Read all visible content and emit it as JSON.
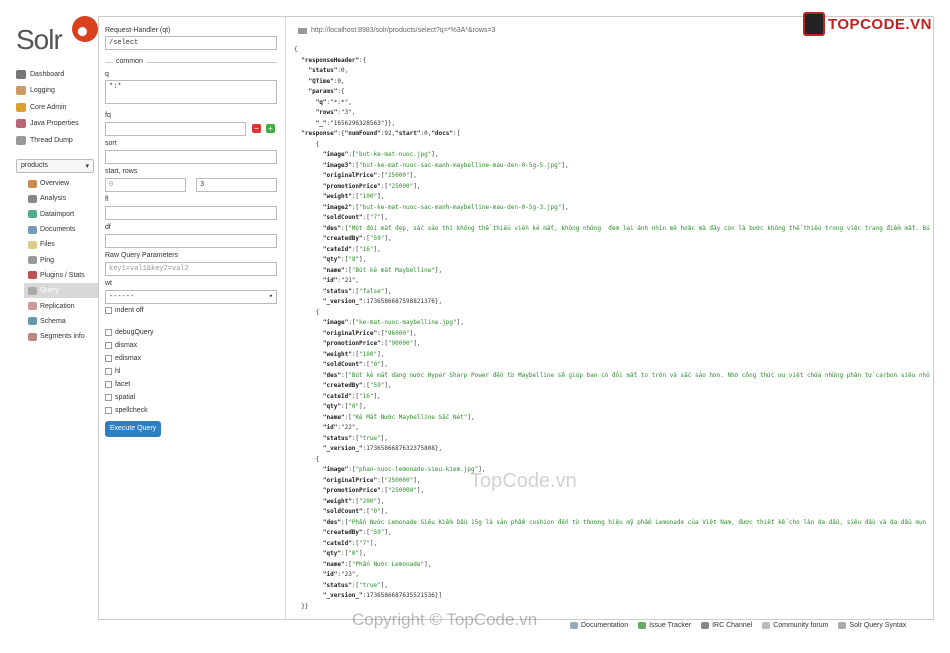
{
  "nav": [
    {
      "label": "Dashboard",
      "icon": "dashboard-icon"
    },
    {
      "label": "Logging",
      "icon": "logging-icon"
    },
    {
      "label": "Core Admin",
      "icon": "core-admin-icon"
    },
    {
      "label": "Java Properties",
      "icon": "java-properties-icon"
    },
    {
      "label": "Thread Dump",
      "icon": "thread-dump-icon"
    }
  ],
  "core_selector": {
    "value": "products"
  },
  "core_nav": [
    {
      "label": "Overview",
      "icon": "overview-icon"
    },
    {
      "label": "Analysis",
      "icon": "analysis-icon"
    },
    {
      "label": "Dataimport",
      "icon": "dataimport-icon"
    },
    {
      "label": "Documents",
      "icon": "documents-icon"
    },
    {
      "label": "Files",
      "icon": "files-icon"
    },
    {
      "label": "Ping",
      "icon": "ping-icon"
    },
    {
      "label": "Plugins / Stats",
      "icon": "plugins-icon"
    },
    {
      "label": "Query",
      "icon": "query-icon"
    },
    {
      "label": "Replication",
      "icon": "replication-icon"
    },
    {
      "label": "Schema",
      "icon": "schema-icon"
    },
    {
      "label": "Segments info",
      "icon": "segments-icon"
    }
  ],
  "form": {
    "qt_label": "Request-Handler (qt)",
    "qt_value": "/select",
    "common_label": "common",
    "q_label": "q",
    "q_value": "*:*",
    "fq_label": "fq",
    "fq_value": "",
    "sort_label": "sort",
    "sort_value": "",
    "start_rows_label": "start, rows",
    "start_placeholder": "0",
    "rows_value": "3",
    "fl_label": "fl",
    "fl_value": "",
    "df_label": "df",
    "df_value": "",
    "raw_label": "Raw Query Parameters",
    "raw_placeholder": "key1=val1&key2=val2",
    "wt_label": "wt",
    "wt_value": "------",
    "indent_label": "indent off",
    "debug_label": "debugQuery",
    "dismax_label": "dismax",
    "edismax_label": "edismax",
    "hl_label": "hl",
    "facet_label": "facet",
    "spatial_label": "spatial",
    "spellcheck_label": "spellcheck",
    "execute_label": "Execute Query"
  },
  "result": {
    "url": "http://localhost:8983/solr/products/select?q=*%3A*&rows=3",
    "json_lines": [
      "{",
      "  \"responseHeader\":{",
      "    \"status\":0,",
      "    \"QTime\":0,",
      "    \"params\":{",
      "      \"q\":\"*:*\",",
      "      \"rows\":\"3\",",
      "      \"_\":\"1656296328563\"}},",
      "  \"response\":{\"numFound\":92,\"start\":0,\"docs\":[",
      "      {",
      "        \"image\":[\"but-ke-mat-nuoc.jpg\"],",
      "        \"image3\":[\"but-ke-mat-nuoc-sac-manh-maybelline-mau-den-0-5g-5.jpg\"],",
      "        \"originalPrice\":[\"25000\"],",
      "        \"promotionPrice\":[\"25000\"],",
      "        \"weight\":[\"100\"],",
      "        \"image2\":[\"but-ke-mat-nuoc-sac-manh-maybelline-mau-den-0-5g-3.jpg\"],",
      "        \"soldCount\":[\"7\"],",
      "        \"des\":[\"Một đôi mắt đẹp, sắc sảo thì không thể thiếu viền kẻ mắt, không những  đem lại ánh nhìn mê hoặc mà đây còn là bước không thể thiếu trong việc trang điểm mắt. Bú",
      "        \"createdBy\":[\"59\"],",
      "        \"cateId\":[\"16\"],",
      "        \"qty\":[\"8\"],",
      "        \"name\":[\"Bút kẻ mắt Maybelline\"],",
      "        \"id\":\"21\",",
      "        \"status\":[\"false\"],",
      "        \"_version_\":1736586687598821376},",
      "      {",
      "        \"image\":[\"ke-mat-nuoc-maybelline.jpg\"],",
      "        \"originalPrice\":[\"96000\"],",
      "        \"promotionPrice\":[\"90000\"],",
      "        \"weight\":[\"100\"],",
      "        \"soldCount\":[\"0\"],",
      "        \"des\":[\"Bút kẻ mắt dạng nước Hyper Sharp Power đến từ Maybelline sẽ giúp bạn có đôi mắt to tròn và sắc sảo hơn. Nhờ công thức ưu việt chứa những phân tử carbon siêu nhỏ",
      "        \"createdBy\":[\"59\"],",
      "        \"cateId\":[\"16\"],",
      "        \"qty\":[\"0\"],",
      "        \"name\":[\"Kẻ Mắt Nước Maybelline Sắc Nét\"],",
      "        \"id\":\"22\",",
      "        \"status\":[\"true\"],",
      "        \"_version_\":1736586687632375808},",
      "      {",
      "        \"image\":[\"phan-nuoc-lemonade-sieu-kiem.jpg\"],",
      "        \"originalPrice\":[\"250000\"],",
      "        \"promotionPrice\":[\"250000\"],",
      "        \"weight\":[\"200\"],",
      "        \"soldCount\":[\"0\"],",
      "        \"des\":[\"Phấn Nước Lemonade Siêu Kiềm Dầu 15g là sản phẩm cushion đến từ thương hiệu mỹ phẩm Lemonade của Việt Nam, được thiết kế cho làn da dầu, siêu dầu và da dầu mụn",
      "        \"createdBy\":[\"59\"],",
      "        \"cateId\":[\"7\"],",
      "        \"qty\":[\"0\"],",
      "        \"name\":[\"Phấn Nước Lemonade\"],",
      "        \"id\":\"23\",",
      "        \"status\":[\"true\"],",
      "        \"_version_\":1736586687635521536}]",
      "  }}"
    ]
  },
  "brand": {
    "label": "TOPCODE.VN"
  },
  "watermark": {
    "text": "TopCode.vn"
  },
  "copyright": {
    "text": "Copyright © TopCode.vn"
  },
  "footer": [
    {
      "label": "Documentation",
      "icon": "documentation-icon"
    },
    {
      "label": "Issue Tracker",
      "icon": "issue-tracker-icon"
    },
    {
      "label": "IRC Channel",
      "icon": "irc-channel-icon"
    },
    {
      "label": "Community forum",
      "icon": "community-forum-icon"
    },
    {
      "label": "Solr Query Syntax",
      "icon": "query-syntax-icon"
    }
  ]
}
